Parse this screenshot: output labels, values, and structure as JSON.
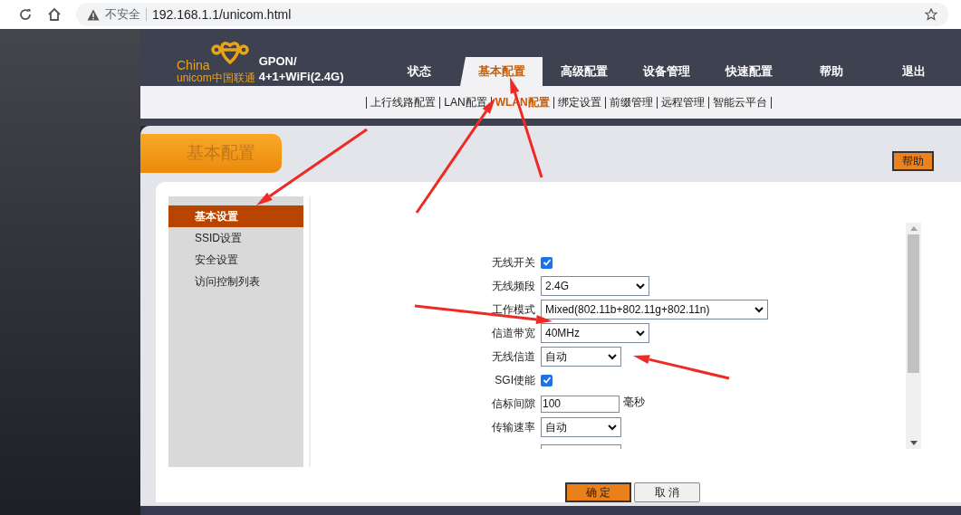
{
  "browser": {
    "security_label": "不安全",
    "url": "192.168.1.1/unicom.html"
  },
  "logo": {
    "line_1": "China",
    "line_2": "unicom中国联通"
  },
  "model": {
    "line_1": "GPON/",
    "line_2": "4+1+WiFi(2.4G)"
  },
  "nav_tabs": [
    {
      "label": "状态",
      "selected": false
    },
    {
      "label": "基本配置",
      "selected": true
    },
    {
      "label": "高级配置",
      "selected": false
    },
    {
      "label": "设备管理",
      "selected": false
    },
    {
      "label": "快速配置",
      "selected": false
    },
    {
      "label": "帮助",
      "selected": false
    },
    {
      "label": "退出",
      "selected": false
    }
  ],
  "sub_nav": [
    {
      "label": "上行线路配置",
      "selected": false
    },
    {
      "label": "LAN配置",
      "selected": false
    },
    {
      "label": "WLAN配置",
      "selected": true
    },
    {
      "label": "绑定设置",
      "selected": false
    },
    {
      "label": "前缀管理",
      "selected": false
    },
    {
      "label": "远程管理",
      "selected": false
    },
    {
      "label": "智能云平台",
      "selected": false
    }
  ],
  "page_title": "基本配置",
  "help_button": "帮助",
  "sidebar": {
    "items": [
      {
        "label": "基本设置",
        "selected": true
      },
      {
        "label": "SSID设置",
        "selected": false
      },
      {
        "label": "安全设置",
        "selected": false
      },
      {
        "label": "访问控制列表",
        "selected": false
      }
    ]
  },
  "form": {
    "fields": [
      {
        "kind": "checkbox",
        "label": "无线开关",
        "checked": true
      },
      {
        "kind": "select",
        "label": "无线频段",
        "value": "2.4G"
      },
      {
        "kind": "select",
        "label": "工作模式",
        "value": "Mixed(802.11b+802.11g+802.11n)"
      },
      {
        "kind": "select",
        "label": "信道带宽",
        "value": "40MHz"
      },
      {
        "kind": "select",
        "label": "无线信道",
        "value": "自动"
      },
      {
        "kind": "checkbox",
        "label": "SGI使能",
        "checked": true
      },
      {
        "kind": "input",
        "label": "信标间隙",
        "value": "100",
        "unit": "毫秒"
      },
      {
        "kind": "select",
        "label": "传输速率",
        "value": "自动"
      }
    ]
  },
  "buttons": [
    {
      "label": "确 定",
      "kind": "primary"
    },
    {
      "label": "取 消",
      "kind": "secondary"
    }
  ]
}
